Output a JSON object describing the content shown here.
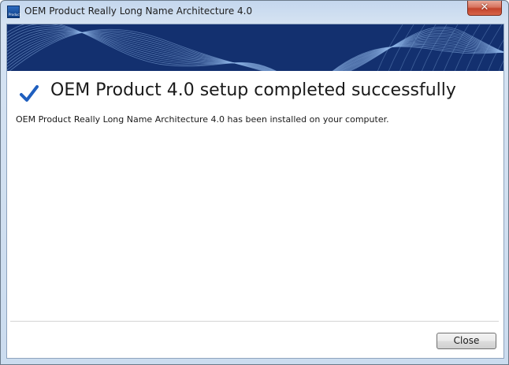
{
  "window": {
    "title": "OEM Product Really Long Name Architecture 4.0",
    "app_icon": "product-app-icon",
    "app_icon_text": "Product",
    "close_glyph": "✕"
  },
  "banner": {
    "style": "dark-blue-wave-lines"
  },
  "content": {
    "status_icon": "checkmark-icon",
    "heading": "OEM Product 4.0 setup completed successfully",
    "message": "OEM Product Really Long Name Architecture 4.0 has been installed on your computer."
  },
  "footer": {
    "close_label": "Close"
  },
  "colors": {
    "banner_bg": "#13306f",
    "checkmark": "#1f5fbf",
    "frame": "#cbdcef"
  }
}
